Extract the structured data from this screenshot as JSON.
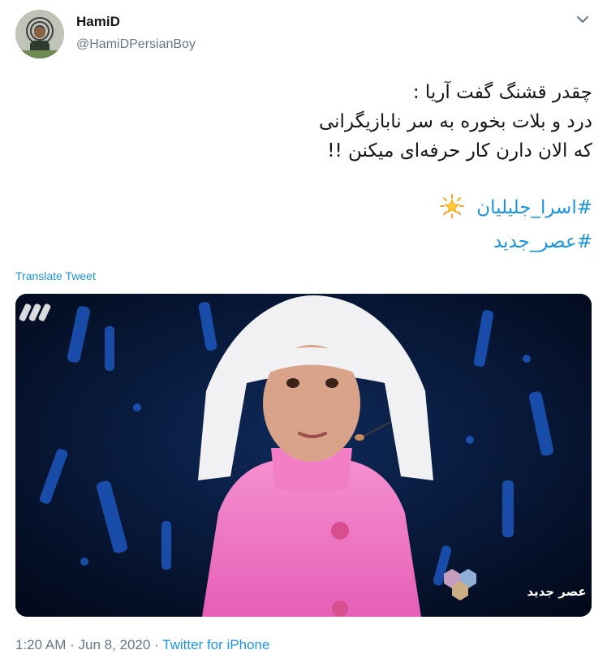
{
  "author": {
    "name": "HamiD",
    "handle": "@HamiDPersianBoy",
    "avatar_icon": "profile-photo"
  },
  "tweet": {
    "lines": [
      "چقدر قشنگ گفت آریا :",
      "درد و بلات بخوره به سر نابازیگرانی",
      "که الان دارن کار حرفه‌ای میکنن !!"
    ],
    "hashtags": [
      "#اسرا_جلیلیان",
      "#عصر_جدید"
    ],
    "emoji": "glowing-star",
    "translate_label": "Translate Tweet"
  },
  "media": {
    "description_icon": "photo",
    "watermark_text": "عصر جدید"
  },
  "meta": {
    "time": "1:20 AM",
    "separator": " · ",
    "date": "Jun 8, 2020",
    "source": "Twitter for iPhone"
  },
  "colors": {
    "link": "#1b95e0",
    "secondary": "#657786",
    "text": "#14171a"
  }
}
